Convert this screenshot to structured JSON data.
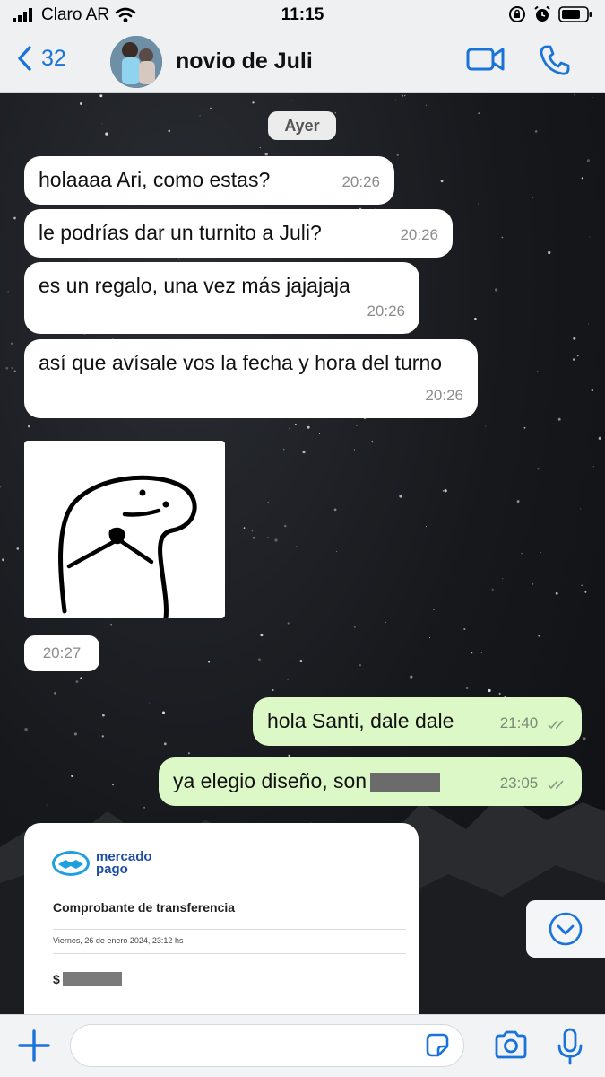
{
  "status_bar": {
    "carrier": "Claro AR",
    "time": "11:15"
  },
  "header": {
    "back_count": "32",
    "contact_name": "novio de Juli"
  },
  "chat": {
    "date_label": "Ayer",
    "messages": [
      {
        "direction": "in",
        "text": "holaaaa Ari, como estas?",
        "time": "20:26"
      },
      {
        "direction": "in",
        "text": "le podrías dar un turnito a Juli?",
        "time": "20:26"
      },
      {
        "direction": "in",
        "text": "es un regalo, una vez más jajajaja",
        "time": "20:26"
      },
      {
        "direction": "in",
        "text": "así que avísale vos la fecha y hora del turno",
        "time": "20:26"
      },
      {
        "direction": "out",
        "text": "hola Santi, dale dale",
        "time": "21:40"
      },
      {
        "direction": "out",
        "text": "ya elegio diseño, son",
        "time": "23:05"
      }
    ],
    "sticker_time": "20:27",
    "receipt": {
      "brand_line1": "mercado",
      "brand_line2": "pago",
      "title": "Comprobante de transferencia",
      "date": "Viernes, 26 de enero 2024, 23:12 hs",
      "amount_prefix": "$"
    }
  },
  "input_bar": {
    "placeholder": ""
  },
  "colors": {
    "accent": "#1a73d9",
    "outgoing_bubble": "#dcf8c6",
    "incoming_bubble": "#ffffff"
  },
  "icons": [
    "back-chevron-icon",
    "video-call-icon",
    "phone-icon",
    "chevron-down-icon",
    "plus-icon",
    "sticker-icon",
    "camera-icon",
    "microphone-icon"
  ]
}
